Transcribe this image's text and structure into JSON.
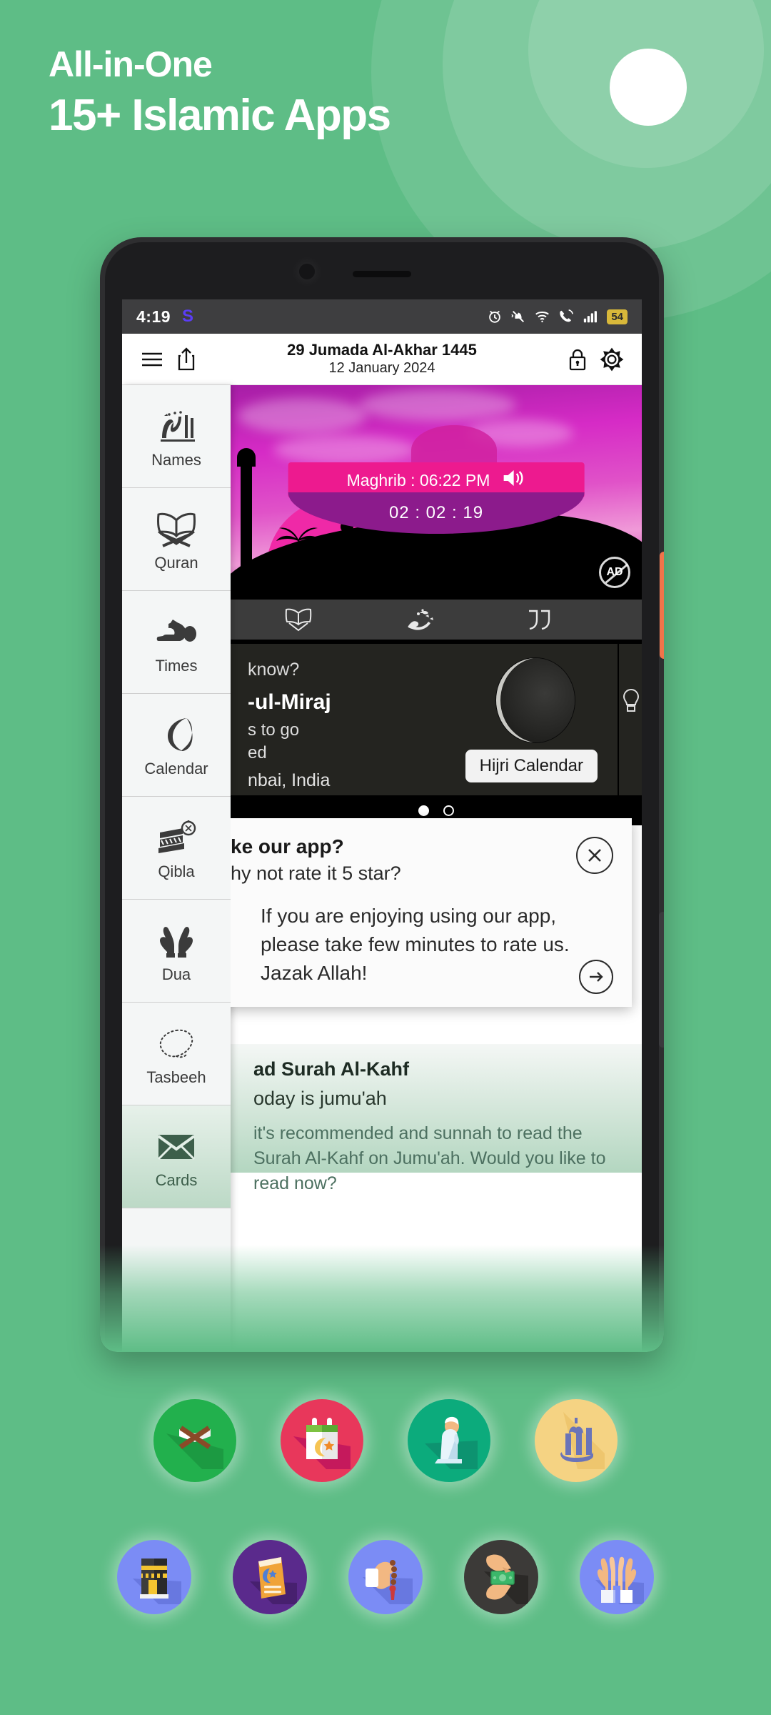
{
  "promo": {
    "line1": "All-in-One",
    "line2": "15+ Islamic Apps",
    "background_color": "#5ebd86",
    "accent_color": "#ffffff"
  },
  "phone": {
    "statusbar": {
      "time": "4:19",
      "badge_letter": "S",
      "badge_color": "#5b3df5",
      "battery_percent": "54",
      "icons": [
        "alarm-icon",
        "mute-icon",
        "wifi-icon",
        "call-icon",
        "signal-icon",
        "battery-icon"
      ]
    },
    "appbar": {
      "menu_icon": "hamburger-menu-icon",
      "share_icon": "share-icon",
      "hijri_date": "29 Jumada Al-Akhar 1445",
      "gregorian_date": "12 January 2024",
      "lock_icon": "lock-icon",
      "settings_icon": "gear-icon"
    },
    "sidebar": {
      "items": [
        {
          "label": "Names",
          "icon": "allah-calligraphy-icon"
        },
        {
          "label": "Quran",
          "icon": "open-quran-icon"
        },
        {
          "label": "Times",
          "icon": "prostration-icon"
        },
        {
          "label": "Calendar",
          "icon": "crescent-moon-icon"
        },
        {
          "label": "Qibla",
          "icon": "kaaba-compass-icon"
        },
        {
          "label": "Dua",
          "icon": "praying-hands-icon"
        },
        {
          "label": "Tasbeeh",
          "icon": "prayer-beads-icon"
        },
        {
          "label": "Cards",
          "icon": "envelope-icon"
        }
      ]
    },
    "hero": {
      "prayer_label": "Maghrib : 06:22 PM",
      "speaker_icon": "speaker-icon",
      "countdown": "02 : 02 : 19",
      "ad_badge": "AD"
    },
    "tabs": [
      {
        "icon": "open-book-icon"
      },
      {
        "icon": "muhammad-calligraphy-icon"
      },
      {
        "icon": "quote-marks-icon"
      }
    ],
    "info_card": {
      "title": "know?",
      "event": "-ul-Miraj",
      "line1": "s to go",
      "line2": "ed",
      "location": "nbai, India",
      "button": "Hijri Calendar",
      "moon_icon": "moon-phase-icon",
      "bulb_icon": "lightbulb-icon",
      "pager": {
        "count": 2,
        "active": 0
      }
    },
    "rate_dialog": {
      "title": "ke our app?",
      "subtitle": "hy not rate it 5 star?",
      "body": "If you are enjoying using our app, please take few minutes to rate us. Jazak Allah!",
      "close_icon": "close-icon",
      "next_icon": "arrow-right-icon"
    },
    "surah_card": {
      "title": "ad Surah Al-Kahf",
      "subtitle": "oday is jumu'ah",
      "body": "it's recommended and sunnah to read the Surah Al-Kahf on Jumu'ah. Would you like to read now?"
    }
  },
  "app_icons": {
    "row1": [
      {
        "name": "quran-app-icon",
        "color": "#22b04d"
      },
      {
        "name": "calendar-app-icon",
        "color": "#e8375b"
      },
      {
        "name": "prayer-app-icon",
        "color": "#0cab7c"
      },
      {
        "name": "names-app-icon",
        "color": "#f5d383"
      }
    ],
    "row2": [
      {
        "name": "qibla-app-icon",
        "color": "#7b8cf5"
      },
      {
        "name": "dua-book-app-icon",
        "color": "#5a2a8c"
      },
      {
        "name": "tasbeeh-app-icon",
        "color": "#7b8cf5"
      },
      {
        "name": "zakat-app-icon",
        "color": "#3c3a38"
      },
      {
        "name": "hands-app-icon",
        "color": "#7b8cf5"
      }
    ]
  }
}
